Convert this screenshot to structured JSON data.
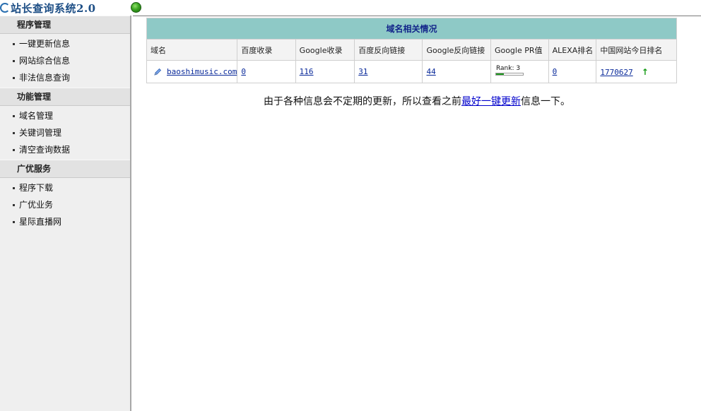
{
  "header": {
    "title": "站长查询系统2.0"
  },
  "sidebar": {
    "sections": [
      {
        "title": "程序管理",
        "items": [
          "一键更新信息",
          "网站综合信息",
          "非法信息查询"
        ]
      },
      {
        "title": "功能管理",
        "items": [
          "域名管理",
          "关键词管理",
          "清空查询数据"
        ]
      },
      {
        "title": "广优服务",
        "items": [
          "程序下载",
          "广优业务",
          "星际直播网"
        ]
      }
    ]
  },
  "table": {
    "caption": "域名相关情况",
    "headers": [
      "域名",
      "百度收录",
      "Google收录",
      "百度反向链接",
      "Google反向链接",
      "Google PR值",
      "ALEXA排名",
      "中国网站今日排名"
    ],
    "row": {
      "domain": "baoshimusic.com",
      "baidu_index": "0",
      "google_index": "116",
      "baidu_backlinks": "31",
      "google_backlinks": "44",
      "pr_label": "Rank: 3",
      "pr_value": 3,
      "pr_max": 10,
      "alexa": "0",
      "china_rank": "1770627",
      "trend": "↑"
    }
  },
  "notice": {
    "before": "由于各种信息会不定期的更新，所以查看之前",
    "link": "最好一键更新",
    "after": "信息一下。"
  },
  "colors": {
    "caption_bg": "#8ec9c6",
    "link": "#0a2a9a",
    "status": "#3aa321"
  }
}
